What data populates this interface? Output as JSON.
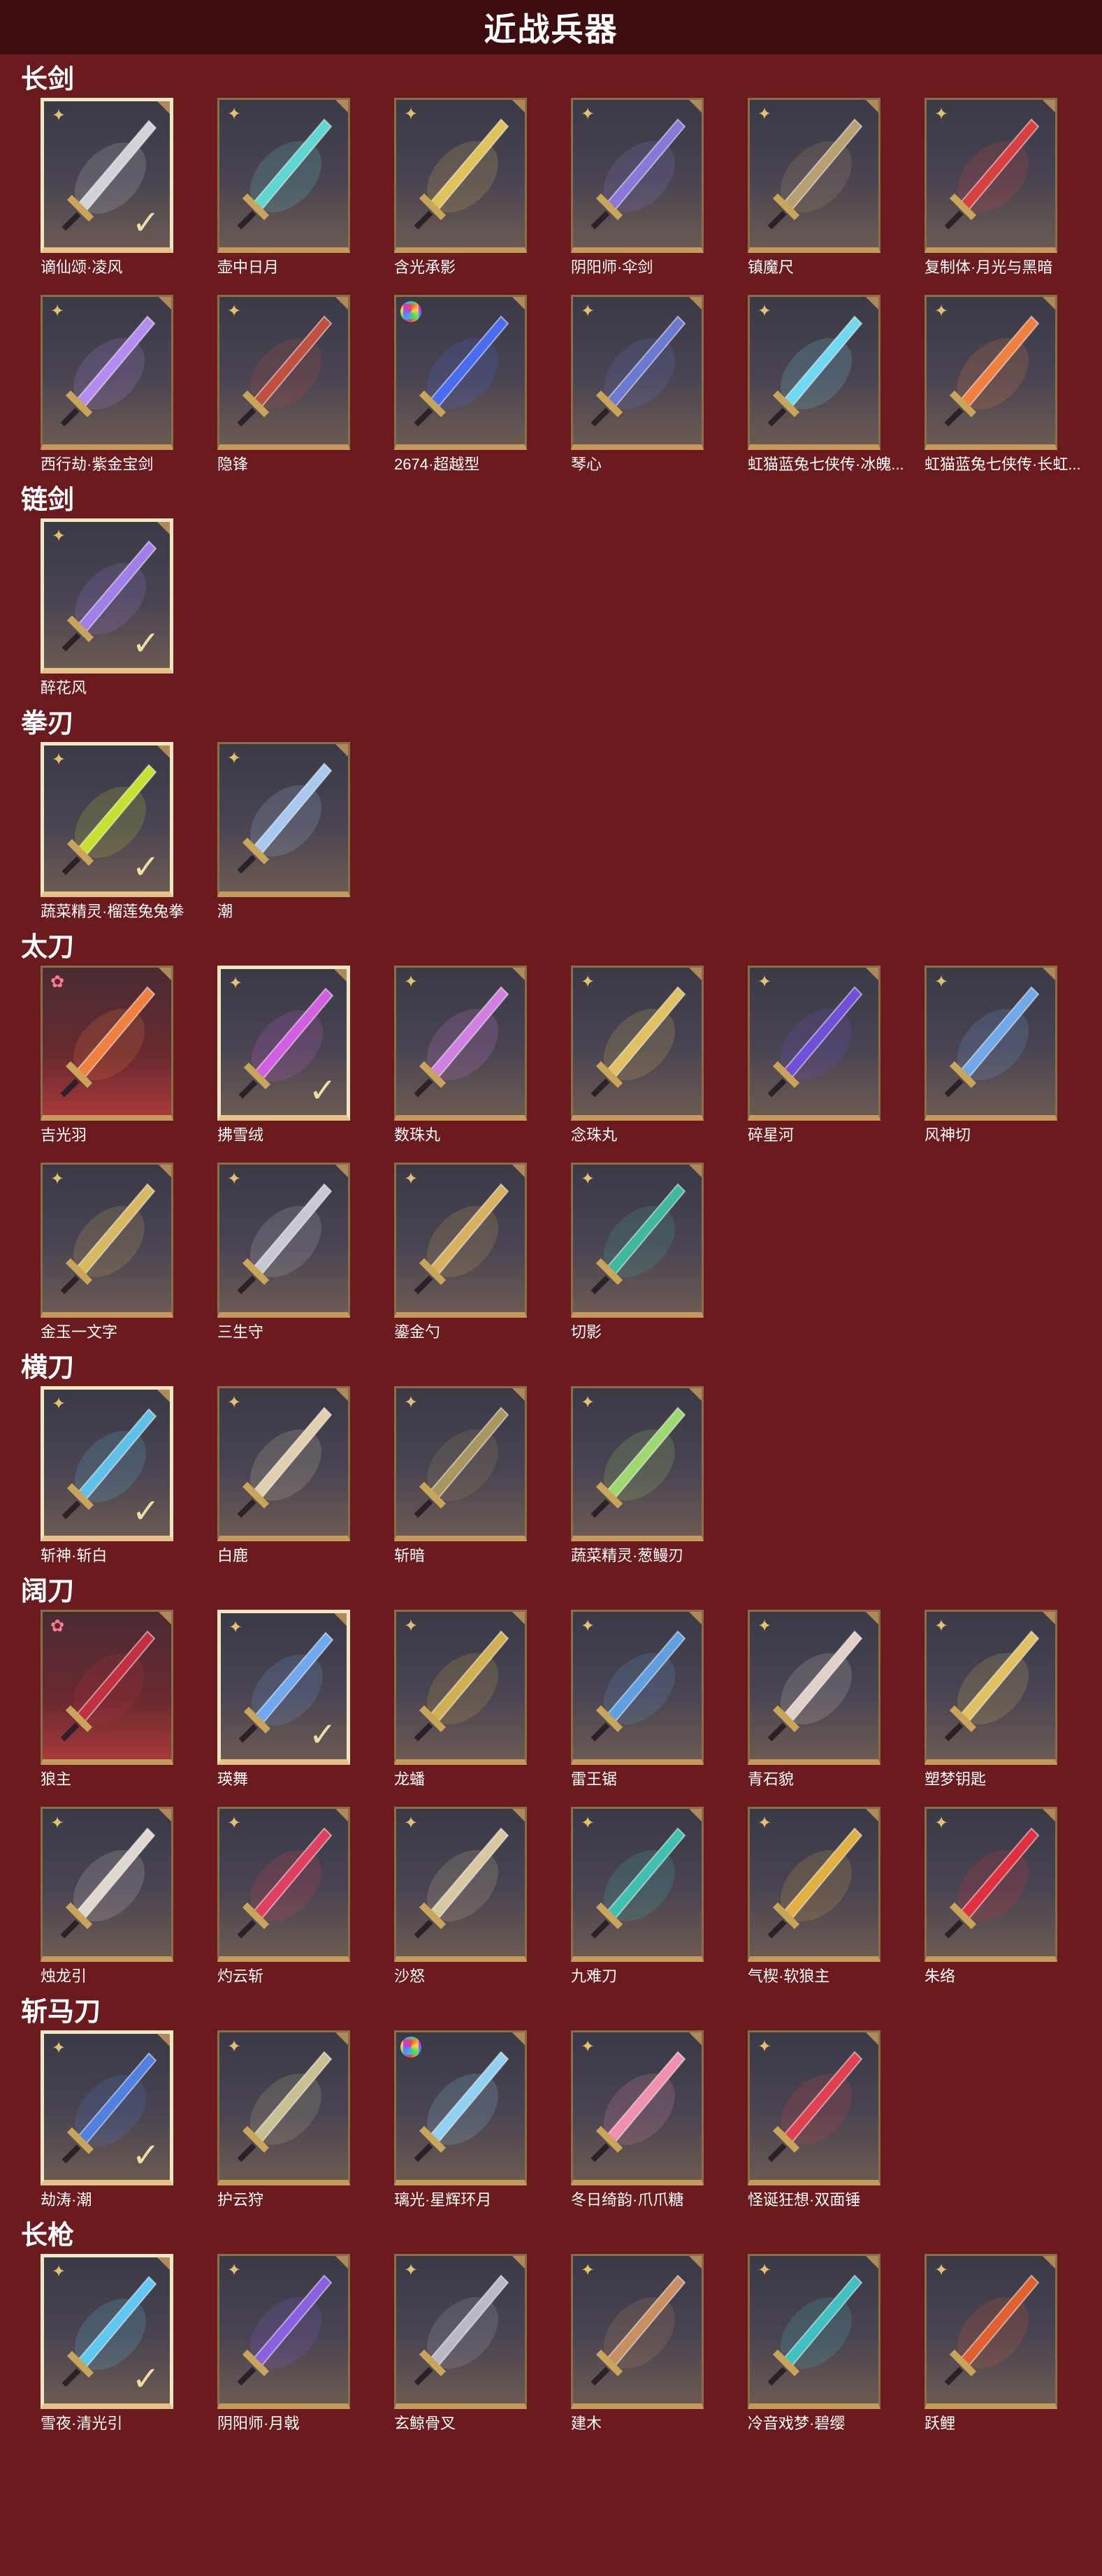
{
  "page": {
    "title": "近战兵器"
  },
  "categories": [
    {
      "id": "changjian",
      "name": "长剑",
      "items": [
        {
          "name": "谪仙颂·凌风",
          "rarity": "gold",
          "selected": true,
          "color": "#cfd3d8"
        },
        {
          "name": "壶中日月",
          "rarity": "gold",
          "selected": false,
          "color": "#5fd6d0"
        },
        {
          "name": "含光承影",
          "rarity": "gold",
          "selected": false,
          "color": "#e0c25a"
        },
        {
          "name": "阴阳师·伞剑",
          "rarity": "gold",
          "selected": false,
          "color": "#8a78d8"
        },
        {
          "name": "镇魔尺",
          "rarity": "gold",
          "selected": false,
          "color": "#b8a070"
        },
        {
          "name": "复制体·月光与黑暗",
          "rarity": "gold",
          "selected": false,
          "color": "#d84040"
        },
        {
          "name": "西行劫·紫金宝剑",
          "rarity": "gold",
          "selected": false,
          "color": "#b48cf0"
        },
        {
          "name": "隐锋",
          "rarity": "gold",
          "selected": false,
          "color": "#c05040"
        },
        {
          "name": "2674·超越型",
          "rarity": "rainbow",
          "selected": false,
          "color": "#4a6cf0"
        },
        {
          "name": "琴心",
          "rarity": "gold",
          "selected": false,
          "color": "#6a7ad0"
        },
        {
          "name": "虹猫蓝兔七侠传·冰魄...",
          "rarity": "gold",
          "selected": false,
          "color": "#70d8f0"
        },
        {
          "name": "虹猫蓝兔七侠传·长虹...",
          "rarity": "gold",
          "selected": false,
          "color": "#f08040"
        }
      ]
    },
    {
      "id": "lianjian",
      "name": "链剑",
      "items": [
        {
          "name": "醉花风",
          "rarity": "gold",
          "selected": true,
          "color": "#a080e8"
        }
      ]
    },
    {
      "id": "quanren",
      "name": "拳刃",
      "items": [
        {
          "name": "蔬菜精灵·榴莲兔兔拳",
          "rarity": "gold",
          "selected": true,
          "color": "#c8e030"
        },
        {
          "name": "潮",
          "rarity": "gold",
          "selected": false,
          "color": "#a8c8f0"
        }
      ]
    },
    {
      "id": "taidao",
      "name": "太刀",
      "items": [
        {
          "name": "吉光羽",
          "rarity": "pink",
          "selected": false,
          "color": "#f08040"
        },
        {
          "name": "拂雪绒",
          "rarity": "gold",
          "selected": true,
          "color": "#d060e0"
        },
        {
          "name": "数珠丸",
          "rarity": "gold",
          "selected": false,
          "color": "#d080e0"
        },
        {
          "name": "念珠丸",
          "rarity": "gold",
          "selected": false,
          "color": "#e0c060"
        },
        {
          "name": "碎星河",
          "rarity": "gold",
          "selected": false,
          "color": "#7050d8"
        },
        {
          "name": "风神切",
          "rarity": "gold",
          "selected": false,
          "color": "#70a8e8"
        },
        {
          "name": "金玉一文字",
          "rarity": "gold",
          "selected": false,
          "color": "#d8b860"
        },
        {
          "name": "三生守",
          "rarity": "gold",
          "selected": false,
          "color": "#c8c8d0"
        },
        {
          "name": "鎏金勺",
          "rarity": "gold",
          "selected": false,
          "color": "#d8b060"
        },
        {
          "name": "切影",
          "rarity": "gold",
          "selected": false,
          "color": "#40b8a0"
        }
      ]
    },
    {
      "id": "hengdao",
      "name": "横刀",
      "items": [
        {
          "name": "斩神·斩白",
          "rarity": "gold",
          "selected": true,
          "color": "#60c0e8"
        },
        {
          "name": "白鹿",
          "rarity": "gold",
          "selected": false,
          "color": "#e0d0b0"
        },
        {
          "name": "斩暗",
          "rarity": "gold",
          "selected": false,
          "color": "#a89860"
        },
        {
          "name": "蔬菜精灵·葱鳗刃",
          "rarity": "gold",
          "selected": false,
          "color": "#a0d870"
        }
      ]
    },
    {
      "id": "kuodao",
      "name": "阔刀",
      "items": [
        {
          "name": "狼主",
          "rarity": "pink",
          "selected": false,
          "color": "#c03040"
        },
        {
          "name": "瑛舞",
          "rarity": "gold",
          "selected": true,
          "color": "#70a8f0"
        },
        {
          "name": "龙蟠",
          "rarity": "gold",
          "selected": false,
          "color": "#d0b050"
        },
        {
          "name": "雷王锯",
          "rarity": "gold",
          "selected": false,
          "color": "#60a0e0"
        },
        {
          "name": "青石貌",
          "rarity": "gold",
          "selected": false,
          "color": "#e0d0c8"
        },
        {
          "name": "塑梦钥匙",
          "rarity": "gold",
          "selected": false,
          "color": "#e0c060"
        },
        {
          "name": "烛龙引",
          "rarity": "gold",
          "selected": false,
          "color": "#e0d8d0"
        },
        {
          "name": "灼云斩",
          "rarity": "gold",
          "selected": false,
          "color": "#e04060"
        },
        {
          "name": "沙怒",
          "rarity": "gold",
          "selected": false,
          "color": "#d8c8a0"
        },
        {
          "name": "九难刀",
          "rarity": "gold",
          "selected": false,
          "color": "#40c0b0"
        },
        {
          "name": "气楔·软狼主",
          "rarity": "gold",
          "selected": false,
          "color": "#e0b040"
        },
        {
          "name": "朱络",
          "rarity": "gold",
          "selected": false,
          "color": "#e03040"
        }
      ]
    },
    {
      "id": "zhanmadao",
      "name": "斩马刀",
      "items": [
        {
          "name": "劫涛·潮",
          "rarity": "gold",
          "selected": true,
          "color": "#5080e0"
        },
        {
          "name": "护云狩",
          "rarity": "gold",
          "selected": false,
          "color": "#c8c090"
        },
        {
          "name": "璃光·星辉环月",
          "rarity": "rainbow",
          "selected": false,
          "color": "#90d0f0"
        },
        {
          "name": "冬日绮韵·爪爪糖",
          "rarity": "gold",
          "selected": false,
          "color": "#f090b0"
        },
        {
          "name": "怪诞狂想·双面锤",
          "rarity": "gold",
          "selected": false,
          "color": "#e04050"
        }
      ]
    },
    {
      "id": "changqiang",
      "name": "长枪",
      "items": [
        {
          "name": "雪夜·清光引",
          "rarity": "gold",
          "selected": true,
          "color": "#60c8f0"
        },
        {
          "name": "阴阳师·月戟",
          "rarity": "gold",
          "selected": false,
          "color": "#8a60e0"
        },
        {
          "name": "玄鲸骨叉",
          "rarity": "gold",
          "selected": false,
          "color": "#b8b8c8"
        },
        {
          "name": "建木",
          "rarity": "gold",
          "selected": false,
          "color": "#c89060"
        },
        {
          "name": "冷音戏梦·碧缨",
          "rarity": "gold",
          "selected": false,
          "color": "#40c0c0"
        },
        {
          "name": "跃鲤",
          "rarity": "gold",
          "selected": false,
          "color": "#e06030"
        }
      ]
    }
  ]
}
